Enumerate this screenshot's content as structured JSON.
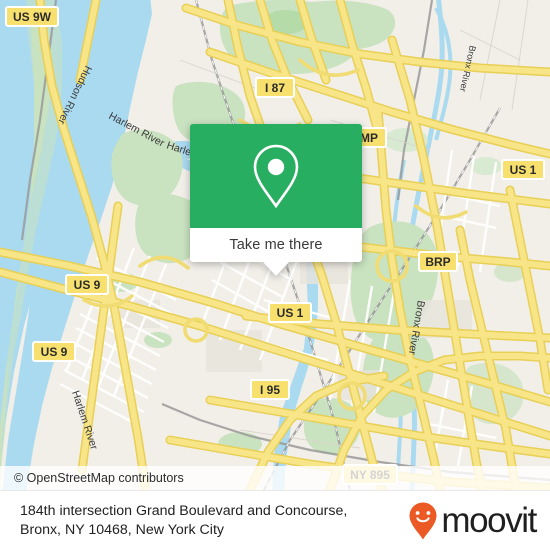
{
  "app": {
    "brand_name": "moovit",
    "brand_color": "#eb5a25",
    "accent_green": "#27ae60"
  },
  "map": {
    "attribution": "© OpenStreetMap contributors",
    "base_color": "#f2efe9",
    "water_color": "#aadaf0",
    "park_color": "#c9e2c0",
    "road_color": "#f7e06e",
    "water_labels": [
      {
        "name": "Hudson River",
        "text": "Hudson River"
      },
      {
        "name": "Harlem River",
        "text": "Harlem River"
      },
      {
        "name": "Harlem River 2",
        "text": "Harlem"
      },
      {
        "name": "Harlem River 3",
        "text": "Harlem River"
      },
      {
        "name": "Bronx River",
        "text": "Bronx River"
      },
      {
        "name": "Bronx River 2",
        "text": "Bronx River"
      }
    ],
    "shields": [
      {
        "label": "US 9W"
      },
      {
        "label": "I 87"
      },
      {
        "label": "MP"
      },
      {
        "label": "US 1"
      },
      {
        "label": "BRP"
      },
      {
        "label": "US 9"
      },
      {
        "label": "US 9"
      },
      {
        "label": "US 1"
      },
      {
        "label": "I 95"
      },
      {
        "label": "NY 895"
      }
    ]
  },
  "popup": {
    "button_label": "Take me there",
    "icon": "map-pin-icon",
    "background": "#27ae60"
  },
  "footer": {
    "address_line1": "184th intersection Grand Boulevard and Concourse,",
    "address_line2": "Bronx, NY 10468, New York City",
    "logo_icon": "moovit-pin-smiley-icon"
  }
}
